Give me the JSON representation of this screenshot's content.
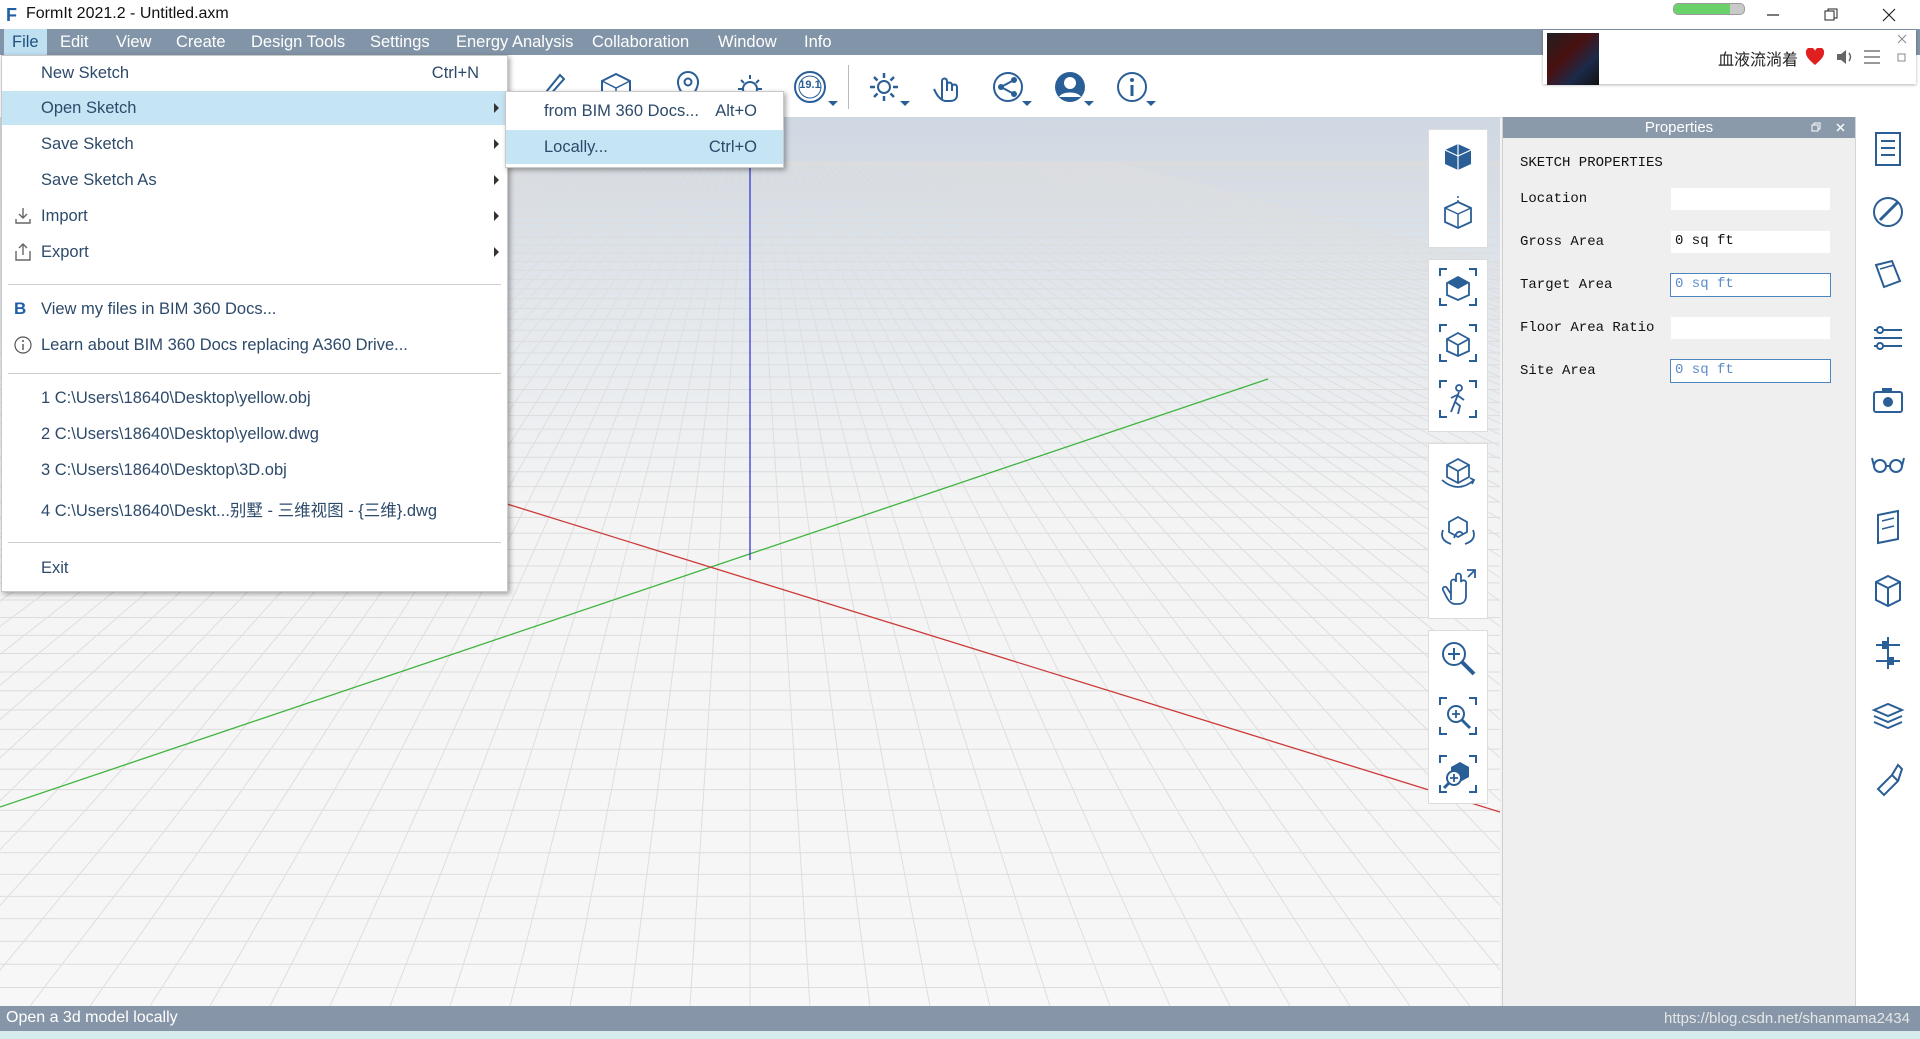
{
  "app": {
    "logo": "F",
    "title": "FormIt 2021.2 - Untitled.axm"
  },
  "title_progress": 0.8,
  "window_controls": [
    "minimize-icon",
    "restore-icon",
    "close-icon"
  ],
  "menubar": [
    {
      "label": "File",
      "active": true
    },
    {
      "label": "Edit"
    },
    {
      "label": "View"
    },
    {
      "label": "Create"
    },
    {
      "label": "Design Tools"
    },
    {
      "label": "Settings"
    },
    {
      "label": "Energy Analysis"
    },
    {
      "label": "Collaboration"
    },
    {
      "label": "Window"
    },
    {
      "label": "Info"
    }
  ],
  "toolbar": {
    "icons": [
      "sketch-tools-icon",
      "model-icon",
      "location-icon",
      "sun-icon",
      "version-badge-icon",
      "settings-gear-icon",
      "touch-icon",
      "share-icon",
      "user-icon",
      "info-icon"
    ],
    "version_badge": "19.1"
  },
  "music_widget": {
    "title": "血液流淌着",
    "icons": [
      "heart-icon",
      "volume-icon",
      "playlist-icon",
      "close-icon",
      "restore-icon"
    ],
    "accent": "#e02020"
  },
  "file_menu": {
    "items": [
      {
        "label": "New Sketch",
        "shortcut": "Ctrl+N"
      },
      {
        "label": "Open Sketch",
        "submenu": true,
        "highlighted": true
      },
      {
        "label": "Save Sketch",
        "submenu": true
      },
      {
        "label": "Save Sketch As",
        "submenu": true
      },
      {
        "label": "Import",
        "submenu": true,
        "icon": "import-icon"
      },
      {
        "label": "Export",
        "submenu": true,
        "icon": "export-icon"
      }
    ],
    "cloud_items": [
      {
        "label": "View my files in BIM 360 Docs...",
        "icon": "bim360-icon"
      },
      {
        "label": "Learn about BIM 360 Docs replacing A360 Drive...",
        "icon": "info-circle-icon"
      }
    ],
    "recent": [
      "1 C:\\Users\\18640\\Desktop\\yellow.obj",
      "2 C:\\Users\\18640\\Desktop\\yellow.dwg",
      "3 C:\\Users\\18640\\Desktop\\3D.obj",
      "4 C:\\Users\\18640\\Deskt...别墅 - 三维视图 - {三维}.dwg"
    ],
    "exit": "Exit"
  },
  "open_submenu": [
    {
      "label": "from BIM 360 Docs...",
      "shortcut": "Alt+O"
    },
    {
      "label": "Locally...",
      "shortcut": "Ctrl+O",
      "highlighted": true
    }
  ],
  "view_tools": [
    "view-cube-icon",
    "axes-view-icon",
    "zoom-extents-icon",
    "iso-view-icon",
    "walk-icon",
    "orbit-icon",
    "look-around-icon",
    "pan-icon",
    "zoom-in-icon",
    "zoom-window-icon",
    "zoom-selection-icon"
  ],
  "properties": {
    "header": "Properties",
    "section": "SKETCH PROPERTIES",
    "fields": [
      {
        "label": "Location",
        "value": ""
      },
      {
        "label": "Gross Area",
        "value": "0 sq ft"
      },
      {
        "label": "Target Area",
        "value": "0 sq ft",
        "editable": true
      },
      {
        "label": "Floor Area Ratio",
        "value": ""
      },
      {
        "label": "Site Area",
        "value": "0 sq ft",
        "editable": true
      }
    ]
  },
  "sidebar_icons": [
    "properties-panel-icon",
    "materials-icon",
    "layers-icon",
    "levels-icon",
    "scenes-icon",
    "visual-styles-icon",
    "groups-icon",
    "components-icon",
    "structure-icon",
    "stack-icon",
    "paint-icon"
  ],
  "status": {
    "text": "Open a 3d model locally",
    "watermark": "https://blog.csdn.net/shanmama2434"
  },
  "axis_colors": {
    "x": "#cc3a3a",
    "y": "#3fb43f",
    "z": "#3a3acc"
  }
}
